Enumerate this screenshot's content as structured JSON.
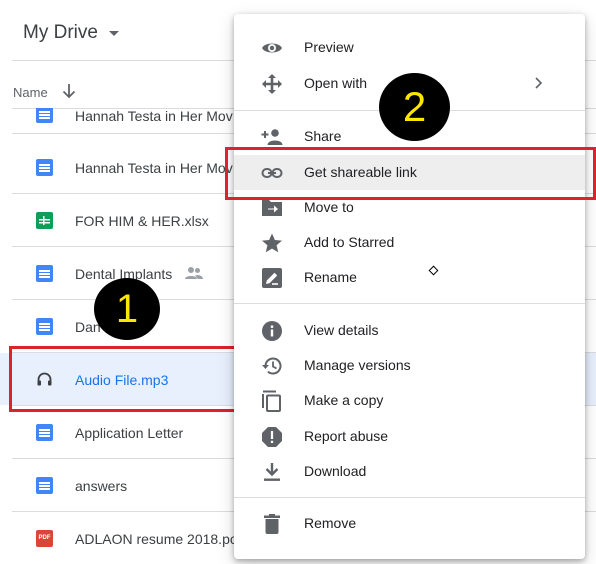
{
  "header": {
    "title": "My Drive"
  },
  "list": {
    "name_header": "Name"
  },
  "files": [
    {
      "name": "Hannah Testa in Her Mov",
      "type": "doc"
    },
    {
      "name": "Hannah Testa in Her Mov",
      "type": "doc"
    },
    {
      "name": "FOR HIM & HER.xlsx",
      "type": "sheet"
    },
    {
      "name": "Dental Implants",
      "type": "doc"
    },
    {
      "name": "Dan     words",
      "type": "doc"
    },
    {
      "name": "Audio File.mp3",
      "type": "audio"
    },
    {
      "name": "Application Letter",
      "type": "doc"
    },
    {
      "name": "answers",
      "type": "doc"
    },
    {
      "name": "ADLAON resume 2018.pc",
      "type": "pdf",
      "icon_text": "PDF"
    }
  ],
  "menu": {
    "items": [
      {
        "label": "Preview",
        "icon": "eye-icon"
      },
      {
        "label": "Open with",
        "icon": "move-arrows-icon"
      },
      {
        "label": "Share",
        "icon": "add-person-icon"
      },
      {
        "label": "Get shareable link",
        "icon": "link-icon"
      },
      {
        "label": "Move to",
        "icon": "move-to-icon"
      },
      {
        "label": "Add to Starred",
        "icon": "star-icon"
      },
      {
        "label": "Rename",
        "icon": "rename-icon"
      },
      {
        "label": "View details",
        "icon": "info-icon"
      },
      {
        "label": "Manage versions",
        "icon": "history-icon"
      },
      {
        "label": "Make a copy",
        "icon": "copy-icon"
      },
      {
        "label": "Report abuse",
        "icon": "report-icon"
      },
      {
        "label": "Download",
        "icon": "download-icon"
      },
      {
        "label": "Remove",
        "icon": "trash-icon"
      }
    ]
  },
  "annotations": {
    "step1": "1",
    "step2": "2"
  },
  "colors": {
    "accent": "#1a73e8",
    "annotation_red": "#d9232e",
    "badge_text": "#ffe600"
  }
}
